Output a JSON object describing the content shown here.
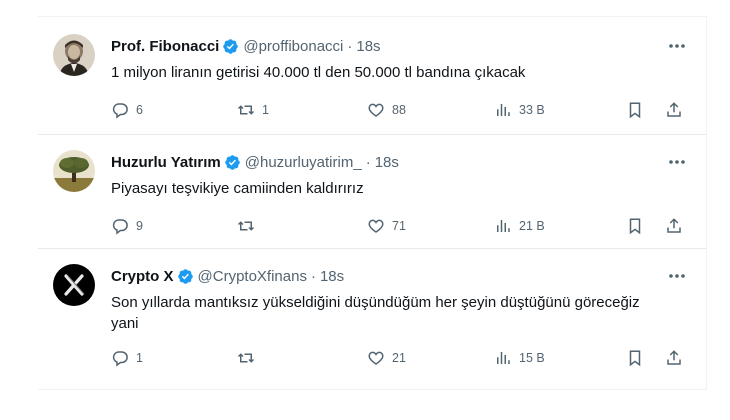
{
  "tweets": [
    {
      "name": "Prof. Fibonacci",
      "handle": "@proffibonacci",
      "separator": "·",
      "time": "18s",
      "text": "1 milyon liranın getirisi 40.000 tl den 50.000 tl bandına çıkacak",
      "replies": "6",
      "retweets": "1",
      "likes": "88",
      "views": "33 B",
      "avatar": "portrait-avatar"
    },
    {
      "name": "Huzurlu Yatırım",
      "handle": "@huzurluyatirim_",
      "separator": "·",
      "time": "18s",
      "text": "Piyasayı teşvikiye camiinden kaldırırız",
      "replies": "9",
      "retweets": "",
      "likes": "71",
      "views": "21 B",
      "avatar": "tree-avatar"
    },
    {
      "name": "Crypto X",
      "handle": "@CryptoXfinans",
      "separator": "·",
      "time": "18s",
      "text": "Son yıllarda mantıksız yükseldiğini düşündüğüm her şeyin düştüğünü göreceğiz yani",
      "replies": "1",
      "retweets": "",
      "likes": "21",
      "views": "15 B",
      "avatar": "x-logo-avatar"
    }
  ],
  "colors": {
    "verified": "#1d9bf0",
    "text": "#0f1419",
    "muted": "#536471",
    "divider": "#e7eaec"
  },
  "icons": [
    "verified-badge-icon",
    "more-icon",
    "reply-icon",
    "retweet-icon",
    "like-icon",
    "views-icon",
    "bookmark-icon",
    "share-icon"
  ]
}
